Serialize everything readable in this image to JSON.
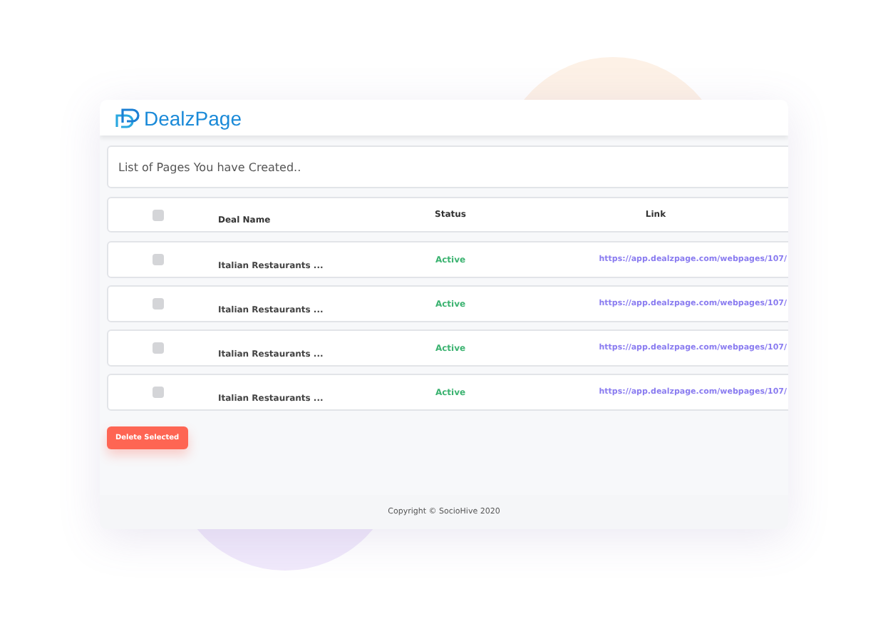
{
  "brand": {
    "name": "DealzPage"
  },
  "panel_title": "List of Pages You have Created..",
  "table": {
    "header": {
      "checked": false
    },
    "columns": [
      "Deal Name",
      "Status",
      "Link"
    ],
    "rows": [
      {
        "checked": false,
        "deal_name": "Italian Restaurants ...",
        "status": "Active",
        "link": "https://app.dealzpage.com/webpages/107/"
      },
      {
        "checked": false,
        "deal_name": "Italian Restaurants ...",
        "status": "Active",
        "link": "https://app.dealzpage.com/webpages/107/"
      },
      {
        "checked": false,
        "deal_name": "Italian Restaurants ...",
        "status": "Active",
        "link": "https://app.dealzpage.com/webpages/107/"
      },
      {
        "checked": false,
        "deal_name": "Italian Restaurants ...",
        "status": "Active",
        "link": "https://app.dealzpage.com/webpages/107/"
      }
    ]
  },
  "delete_button": "Delete Selected",
  "footer": "Copyright © SocioHive 2020"
}
